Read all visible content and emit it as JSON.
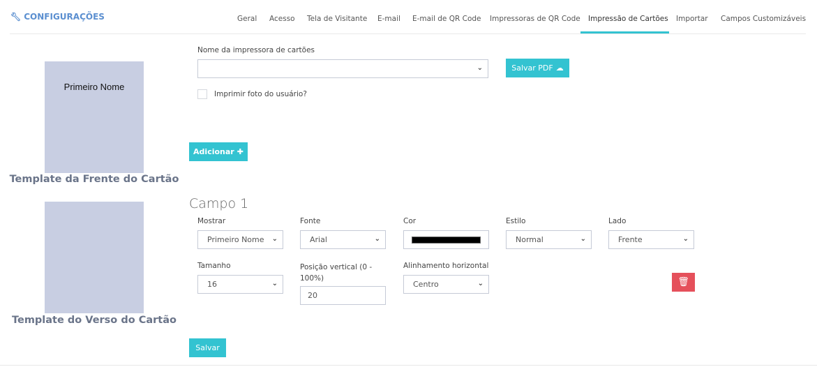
{
  "header": {
    "title": "CONFIGURAÇÕES",
    "icon": "wrench-icon",
    "tabs": [
      {
        "label": "Geral"
      },
      {
        "label": "Acesso"
      },
      {
        "label": "Tela de Visitante"
      },
      {
        "label": "E-mail"
      },
      {
        "label": "E-mail de QR Code"
      },
      {
        "label": "Impressoras de QR Code"
      },
      {
        "label": "Impressão de Cartões",
        "active": true
      },
      {
        "label": "Importar"
      },
      {
        "label": "Campos Customizáveis"
      }
    ]
  },
  "templates": {
    "front_label": "Template da Frente do Cartão",
    "front_preview_text": "Primeiro Nome",
    "back_label": "Template do Verso do Cartão"
  },
  "printer": {
    "label": "Nome da impressora de cartões",
    "value": "",
    "save_pdf": "Salvar PDF",
    "print_photo_label": "Imprimir foto do usuário?",
    "print_photo_checked": false
  },
  "add_button": "Adicionar",
  "field": {
    "title": "Campo 1",
    "show": {
      "label": "Mostrar",
      "value": "Primeiro Nome"
    },
    "font": {
      "label": "Fonte",
      "value": "Arial"
    },
    "color": {
      "label": "Cor",
      "value": "#000000"
    },
    "style": {
      "label": "Estilo",
      "value": "Normal"
    },
    "side": {
      "label": "Lado",
      "value": "Frente"
    },
    "size": {
      "label": "Tamanho",
      "value": "16"
    },
    "vpos": {
      "label": "Posição vertical (0 - 100%)",
      "value": "20"
    },
    "halign": {
      "label": "Alinhamento horizontal",
      "value": "Centro"
    }
  },
  "save_button": "Salvar",
  "colors": {
    "accent": "#33c3d1",
    "danger": "#e5505b",
    "title": "#5b8fd0",
    "card": "#c8cee2"
  }
}
